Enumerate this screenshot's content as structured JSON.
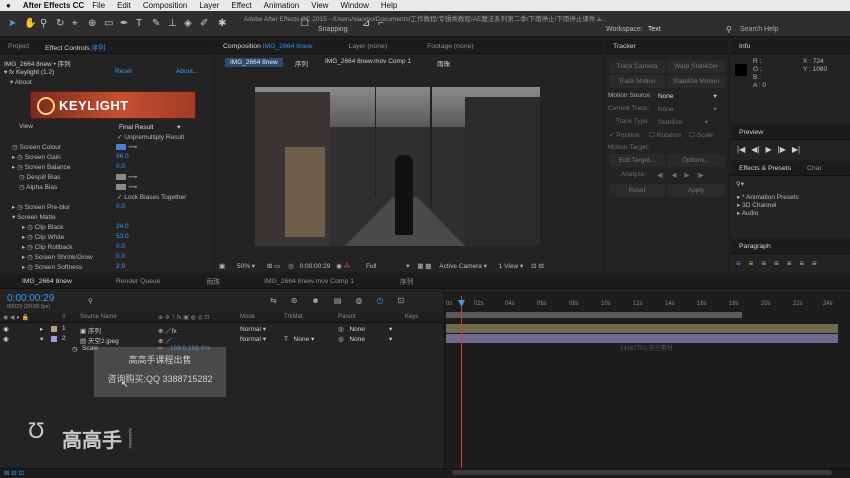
{
  "menubar": {
    "apple": "",
    "app": "After Effects CC",
    "items": [
      "File",
      "Edit",
      "Composition",
      "Layer",
      "Effect",
      "Animation",
      "View",
      "Window",
      "Help"
    ]
  },
  "toolbar": {
    "doc_path": "Adobe After Effects CC 2015 - /Users/xiaomo/Documents/工作教程/专辑类教程/AE魔法系列第二季/下雨停止/下雨停止课件.a...",
    "snapping": "Snapping",
    "workspace_label": "Workspace:",
    "workspace_value": "Text",
    "search_help": "Search Help"
  },
  "project": {
    "tab_project": "Project",
    "tab_effects": "Effect Controls",
    "tab_effects_item": "序列",
    "breadcrumb": "IMG_2664 8new • 序列",
    "fx_name": "Keylight (1.2)",
    "reset": "Reset",
    "about": "About...",
    "about_group": "About",
    "banner": "KEYLIGHT",
    "rows": [
      {
        "label": "View",
        "value": "Final Result"
      },
      {
        "label": "",
        "value": "Unpremultiply Result",
        "check": "✓"
      },
      {
        "label": "Screen Colour",
        "value": ""
      },
      {
        "label": "Screen Gain",
        "value": "96.0"
      },
      {
        "label": "Screen Balance",
        "value": "0.0"
      },
      {
        "label": "Despill Bias",
        "value": ""
      },
      {
        "label": "Alpha Bias",
        "value": ""
      },
      {
        "label": "",
        "value": "Lock Biases Together",
        "check": "✓"
      },
      {
        "label": "Screen Pre-blur",
        "value": "0.0"
      },
      {
        "label": "Screen Matte",
        "value": ""
      },
      {
        "label": "Clip Black",
        "value": "24.0"
      },
      {
        "label": "Clip White",
        "value": "53.0"
      },
      {
        "label": "Clip Rollback",
        "value": "0.0"
      },
      {
        "label": "Screen Shrink/Grow",
        "value": "0.0"
      },
      {
        "label": "Screen Softness",
        "value": "2.9"
      }
    ]
  },
  "comp": {
    "tab_comp": "Composition",
    "tab_comp_name": "IMG_2664 8new",
    "tab_layer": "Layer (none)",
    "tab_footage": "Footage (none)",
    "crumbs": [
      "IMG_2664 8new",
      "序列",
      "IMG_2664 8new.mov Comp 1",
      "雨珠"
    ],
    "zoom": "50%",
    "timecode": "0:00:00:29",
    "resolution": "Full",
    "camera": "Active Camera",
    "views": "1 View"
  },
  "tracker": {
    "tab": "Tracker",
    "track_camera": "Track Camera",
    "warp_stabilizer": "Warp Stabilizer",
    "track_motion": "Track Motion",
    "stabilize_motion": "Stabilize Motion",
    "motion_source_label": "Motion Source:",
    "motion_source": "None",
    "current_track_label": "Current Track:",
    "current_track": "None",
    "track_type_label": "Track Type:",
    "track_type": "Stabilize",
    "position": "Position",
    "rotation": "Rotation",
    "scale": "Scale",
    "motion_target_label": "Motion Target:",
    "edit_target": "Edit Target...",
    "options": "Options...",
    "analyze": "Analyze:",
    "reset": "Reset",
    "apply": "Apply"
  },
  "info": {
    "tab": "Info",
    "r": "R :",
    "g": "G :",
    "b": "B :",
    "a": "A : 0",
    "x": "X : 724",
    "y": "Y : 1080"
  },
  "preview": {
    "tab": "Preview"
  },
  "effects_presets": {
    "tab": "Effects & Presets",
    "tab2": "Char",
    "search_placeholder": "",
    "items": [
      "* Animation Presets",
      "3D Channel",
      "Audio"
    ]
  },
  "paragraph": {
    "tab": "Paragraph"
  },
  "timeline": {
    "tabs": [
      "IMG_2664 8new",
      "Render Queue",
      "雨珠",
      "IMG_2664 8new.mov Comp 1",
      "序列"
    ],
    "timecode": "0:00:00:29",
    "fps": "00029 (30.00 fps)",
    "headers": {
      "source": "Source Name",
      "mode": "Mode",
      "trkmat": "TrkMat",
      "parent": "Parent",
      "keys": "Keys"
    },
    "layers": [
      {
        "num": "1",
        "name": "序列",
        "mode": "Normal",
        "trkmat": "",
        "parent": "None"
      },
      {
        "num": "2",
        "name": "天空2.jpeg",
        "mode": "Normal",
        "trkmat": "None",
        "parent": "None"
      }
    ],
    "scale_label": "Scale",
    "scale_value": "169.0,169.0%",
    "ruler": [
      "0s",
      "02s",
      "04s",
      "06s",
      "08s",
      "10s",
      "12s",
      "14s",
      "16s",
      "18s",
      "20s",
      "22s",
      "24s"
    ],
    "bar_label": "14167701-天空素材"
  },
  "watermark": {
    "line1": "高高手课程出售",
    "line2_a": "咨询购买:",
    "line2_b": "QQ 3388715282",
    "brand": "高高手",
    "brand_small": "GAOSHOU"
  }
}
